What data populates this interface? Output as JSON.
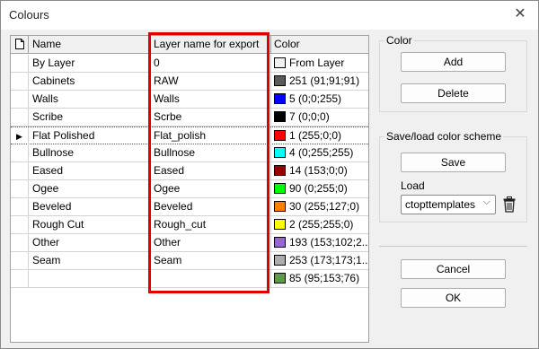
{
  "window": {
    "title": "Colours"
  },
  "grid": {
    "columns": [
      "Name",
      "Layer name for export",
      "Color"
    ],
    "rows": [
      {
        "name": "By Layer",
        "export": "0",
        "color": "#f0f0f0",
        "color_label": "From Layer"
      },
      {
        "name": "Cabinets",
        "export": "RAW",
        "color": "#5b5b5b",
        "color_label": "251 (91;91;91)"
      },
      {
        "name": "Walls",
        "export": "Walls",
        "color": "#0000ff",
        "color_label": "5 (0;0;255)"
      },
      {
        "name": "Scribe",
        "export": "Scrbe",
        "color": "#000000",
        "color_label": "7 (0;0;0)"
      },
      {
        "name": "Flat Polished",
        "export": "Flat_polish",
        "color": "#ff0000",
        "color_label": "1 (255;0;0)",
        "selected": true
      },
      {
        "name": "Bullnose",
        "export": "Bullnose",
        "color": "#00ffff",
        "color_label": "4 (0;255;255)"
      },
      {
        "name": "Eased",
        "export": "Eased",
        "color": "#990000",
        "color_label": "14 (153;0;0)"
      },
      {
        "name": "Ogee",
        "export": "Ogee",
        "color": "#00ff00",
        "color_label": "90 (0;255;0)"
      },
      {
        "name": "Beveled",
        "export": "Beveled",
        "color": "#ff7f00",
        "color_label": "30 (255;127;0)"
      },
      {
        "name": "Rough Cut",
        "export": "Rough_cut",
        "color": "#ffff00",
        "color_label": "2 (255;255;0)"
      },
      {
        "name": "Other",
        "export": "Other",
        "color": "#9966cc",
        "color_label": "193 (153;102;2..."
      },
      {
        "name": "Seam",
        "export": "Seam",
        "color": "#adadad",
        "color_label": "253 (173;173;1..."
      },
      {
        "name": "",
        "export": "",
        "color": "#5f994c",
        "color_label": "85 (95;153;76)"
      }
    ]
  },
  "color_group": {
    "label": "Color",
    "add": "Add",
    "delete": "Delete"
  },
  "scheme_group": {
    "label": "Save/load color scheme",
    "save": "Save",
    "load_label": "Load",
    "load_value": "ctopttemplates"
  },
  "footer": {
    "cancel": "Cancel",
    "ok": "OK"
  },
  "icons": {
    "close": "close-icon",
    "trash": "trash-icon",
    "new_row": "new-row-icon",
    "current_row": "current-row-arrow-icon",
    "chevron": "chevron-down-icon"
  },
  "accent": {
    "highlight": "#e00000"
  }
}
